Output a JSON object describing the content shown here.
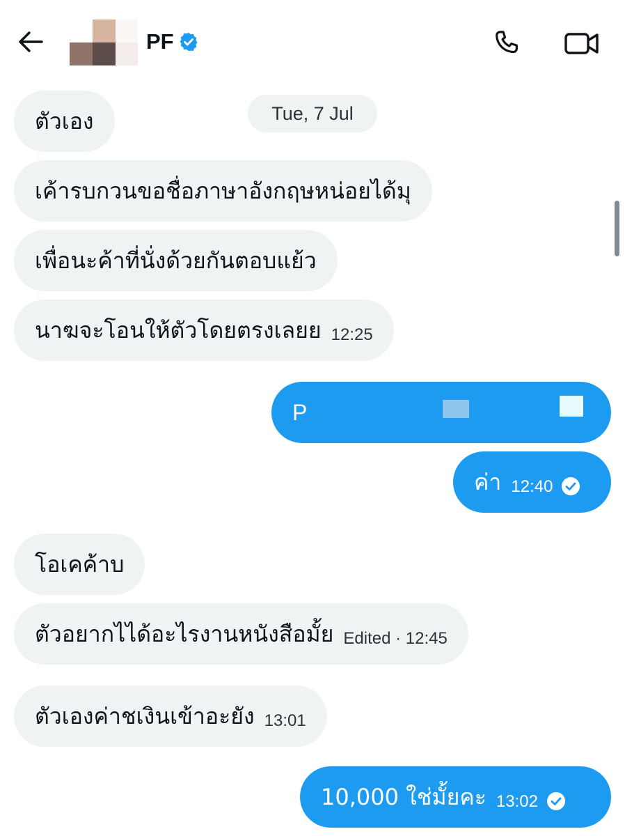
{
  "header": {
    "contact_name": "PF",
    "icons": {
      "back": "arrow-left-icon",
      "verified": "verified-badge-icon",
      "call": "phone-icon",
      "video": "video-camera-icon"
    }
  },
  "conversation": {
    "date_separator": "Tue, 7 Jul",
    "messages": [
      {
        "direction": "received",
        "text": "ตัวเอง"
      },
      {
        "direction": "received",
        "text": "เค้ารบกวนขอชื่อภาษาอังกฤษหน่อยได้มุ"
      },
      {
        "direction": "received",
        "text": "เพื่อนะค้าที่นั่งด้วยกันตอบแย้ว"
      },
      {
        "direction": "received",
        "text": "นาฆจะโอนให้ตัวโดยตรงเลยย",
        "time": "12:25"
      },
      {
        "direction": "sent",
        "text": "P",
        "redacted": true
      },
      {
        "direction": "sent",
        "text": "ค่า",
        "time": "12:40",
        "seen": true
      },
      {
        "direction": "received",
        "text": "โอเคค้าบ"
      },
      {
        "direction": "received",
        "text": "ตัวอยากไได้อะไรงานหนังสือมั้ย",
        "time": "Edited · 12:45"
      },
      {
        "direction": "received",
        "text": "ตัวเองค่าชเงินเข้าอะยัง",
        "time": "13:01"
      },
      {
        "direction": "sent",
        "text": "10,000 ใช่มั้ยคะ",
        "time": "13:02",
        "seen": true
      }
    ]
  },
  "colors": {
    "accent": "#1d9bf0",
    "received_bubble": "#eff3f4",
    "text": "#0f1419",
    "sent_text": "#ffffff",
    "redaction_light": "#e7fbfd",
    "redaction_mid": "#8ec6ee"
  }
}
